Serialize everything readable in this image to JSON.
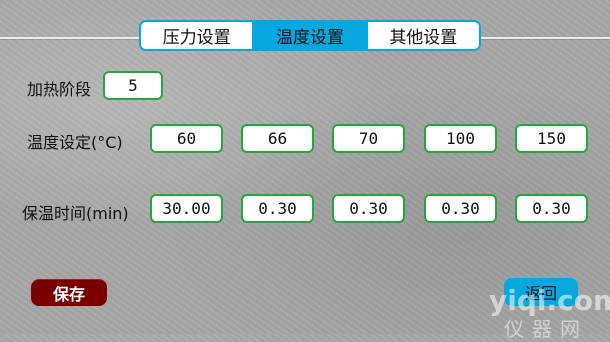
{
  "tabs": [
    {
      "label": "压力设置",
      "active": false
    },
    {
      "label": "温度设置",
      "active": true
    },
    {
      "label": "其他设置",
      "active": false
    }
  ],
  "heating_stage": {
    "label": "加热阶段",
    "value": "5"
  },
  "temperature_settings": {
    "label": "温度设定(°C)",
    "values": [
      "60",
      "66",
      "70",
      "100",
      "150"
    ]
  },
  "hold_time": {
    "label": "保温时间(min)",
    "values": [
      "30.00",
      "0.30",
      "0.30",
      "0.30",
      "0.30"
    ]
  },
  "buttons": {
    "save": "保存",
    "back": "返回"
  },
  "watermark": {
    "main": "yiqi.com",
    "sub": "仪器网"
  },
  "colors": {
    "active_tab": "#07a7df",
    "input_border": "#24a83a",
    "save_button": "#7a0000",
    "back_button": "#08a8de",
    "background": "#a7a7a7"
  }
}
